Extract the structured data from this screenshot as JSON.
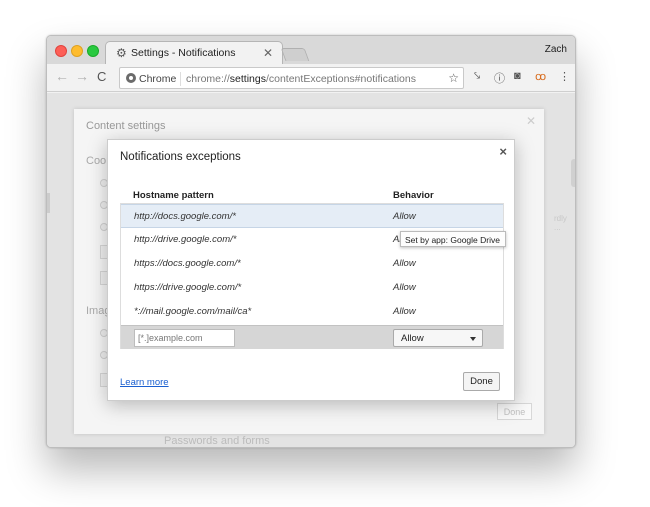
{
  "browser": {
    "tab_title": "Notifications",
    "tab_prefix": "Settings - ",
    "profile_name": "Zach",
    "omnibox_site": "Chrome",
    "omnibox_url_scheme": "chrome://",
    "omnibox_url_host": "settings",
    "omnibox_url_path": "/contentExceptions#notifications"
  },
  "background_dialog": {
    "title": "Content settings",
    "section_cookies": "Coo",
    "section_images": "Imag",
    "section_passwords": "Passwords and forms",
    "done_label": "Done",
    "faint_text": "rdly ..."
  },
  "dialog": {
    "title": "Notifications exceptions",
    "col_hostname": "Hostname pattern",
    "col_behavior": "Behavior",
    "rows": [
      {
        "host": "http://docs.google.com/*",
        "behavior": "Allow"
      },
      {
        "host": "http://drive.google.com/*",
        "behavior": "Al"
      },
      {
        "host": "https://docs.google.com/*",
        "behavior": "Allow"
      },
      {
        "host": "https://drive.google.com/*",
        "behavior": "Allow"
      },
      {
        "host": "*://mail.google.com/mail/ca*",
        "behavior": "Allow"
      }
    ],
    "new_pattern_placeholder": "[*.]example.com",
    "new_behavior_selected": "Allow",
    "tooltip": "Set by app: Google Drive",
    "learn_more": "Learn more",
    "done_label": "Done"
  },
  "colors": {
    "selected_row": "#e5edf6",
    "link": "#1a5fd0",
    "close_red": "#fd5f57",
    "min_yellow": "#febc2e",
    "max_green": "#29c940"
  }
}
